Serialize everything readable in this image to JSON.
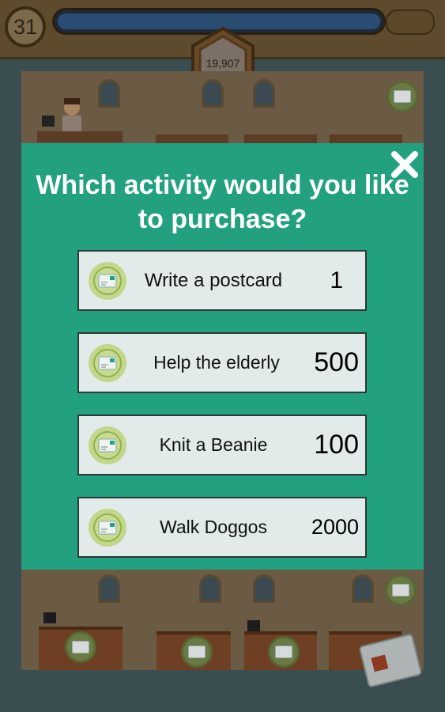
{
  "hud": {
    "level": "31",
    "coins": "19,907"
  },
  "dialog": {
    "question": "Which activity would you like to purchase?",
    "options": [
      {
        "label": "Write a postcard",
        "price": "1",
        "icon": "postcard-icon"
      },
      {
        "label": "Help the elderly",
        "price": "500",
        "icon": "postcard-icon"
      },
      {
        "label": "Knit a Beanie",
        "price": "100",
        "icon": "postcard-icon"
      },
      {
        "label": "Walk Doggos",
        "price": "2000",
        "icon": "postcard-icon"
      }
    ]
  },
  "colors": {
    "modal": "#22a07f",
    "option_bg": "#e2ebe9",
    "icon_circle": "#c3d78b"
  }
}
